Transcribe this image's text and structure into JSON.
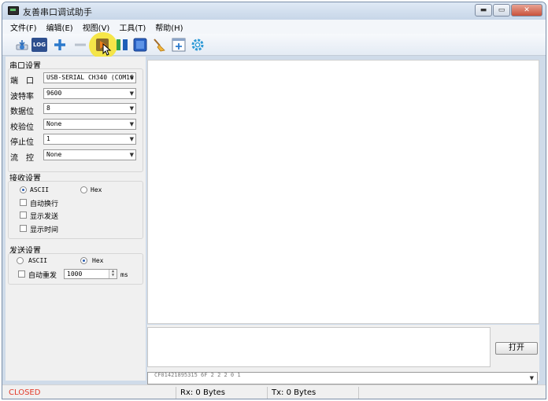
{
  "window": {
    "title": "友善串口调试助手",
    "minimize_glyph": "▬",
    "maximize_glyph": "▭",
    "close_glyph": "✕"
  },
  "menu": [
    "文件(F)",
    "编辑(E)",
    "视图(V)",
    "工具(T)",
    "帮助(H)"
  ],
  "toolbar": {
    "log_label": "LOG",
    "icons": [
      "download-icon",
      "log-icon",
      "add-icon",
      "remove-icon",
      "play-icon",
      "pause-icon",
      "stop-icon",
      "broom-icon",
      "add-window-icon",
      "gear-icon"
    ]
  },
  "serial_settings": {
    "title": "串口设置",
    "port": {
      "label": "端　口",
      "value": "USB-SERIAL CH340 (COM16"
    },
    "baud": {
      "label": "波特率",
      "value": "9600"
    },
    "data_bits": {
      "label": "数据位",
      "value": "8"
    },
    "parity": {
      "label": "校验位",
      "value": "None"
    },
    "stop_bits": {
      "label": "停止位",
      "value": "1"
    },
    "flow": {
      "label": "流　控",
      "value": "None"
    }
  },
  "receive_settings": {
    "title": "接收设置",
    "ascii_label": "ASCII",
    "hex_label": "Hex",
    "mode": "ASCII",
    "auto_newline": "自动换行",
    "show_send": "显示发送",
    "show_time": "显示时间"
  },
  "send_settings": {
    "title": "发送设置",
    "ascii_label": "ASCII",
    "hex_label": "Hex",
    "mode": "Hex",
    "auto_resend": "自动重发",
    "interval_value": "1000",
    "interval_unit": "ms"
  },
  "actions": {
    "open_label": "打开"
  },
  "history": {
    "value": "CF01421895315 6F 2 2 2 0 1"
  },
  "status": {
    "port_state": "CLOSED",
    "rx": "Rx: 0 Bytes",
    "tx": "Tx: 0 Bytes"
  },
  "colors": {
    "closed": "#e23a2a",
    "highlight": "#f5e43a"
  }
}
